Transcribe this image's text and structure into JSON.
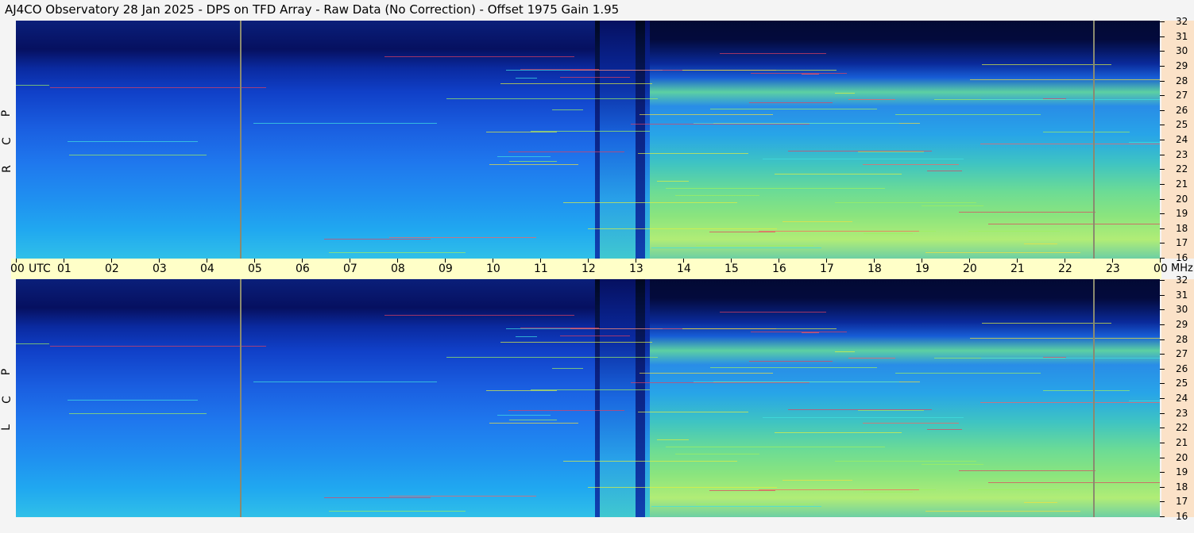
{
  "title": "AJ4CO Observatory  28 Jan 2025  -  DPS on TFD Array  -  Raw Data (No Correction)  -  Offset 1975  Gain 1.95",
  "panels": [
    {
      "id": "rcp",
      "label_letters": [
        "P",
        "C",
        "R"
      ]
    },
    {
      "id": "lcp",
      "label_letters": [
        "P",
        "C",
        "L"
      ]
    }
  ],
  "time_axis": {
    "labels": [
      "00",
      "01",
      "02",
      "03",
      "04",
      "05",
      "06",
      "07",
      "08",
      "09",
      "10",
      "11",
      "12",
      "13",
      "14",
      "15",
      "16",
      "17",
      "18",
      "19",
      "20",
      "21",
      "22",
      "23",
      "00"
    ],
    "unit": "UTC"
  },
  "freq_axis": {
    "labels": [
      "32",
      "31",
      "30",
      "29",
      "28",
      "27",
      "26",
      "25",
      "24",
      "23",
      "22",
      "21",
      "20",
      "19",
      "18",
      "17",
      "16"
    ],
    "unit": "MHz"
  },
  "colors": {
    "background": "#f4f4f4",
    "time_bar": "#ffffc8",
    "freq_bar": "#fbe2c8",
    "marker_line": "#8a8a70"
  },
  "chart_data": {
    "type": "heatmap",
    "title": "AJ4CO Observatory  28 Jan 2025  -  DPS on TFD Array  -  Raw Data (No Correction)  -  Offset 1975  Gain 1.95",
    "x_label": "UTC",
    "y_label": "MHz",
    "x_range_hours": [
      0,
      24
    ],
    "y_range_mhz": [
      16,
      32
    ],
    "panels": [
      "RCP",
      "LCP"
    ],
    "marker_times_utc_hours": [
      4.7,
      22.6
    ],
    "colormap": "jet (dark blue = low, cyan/green = mid, yellow/red = high)",
    "description_levels": [
      {
        "t_start": 0,
        "t_end": 12.2,
        "level": "low (blue)"
      },
      {
        "t_start": 12.2,
        "t_end": 13.3,
        "level": "transition"
      },
      {
        "t_start": 13.3,
        "t_end": 24,
        "level": "high (green-yellow)"
      }
    ]
  }
}
